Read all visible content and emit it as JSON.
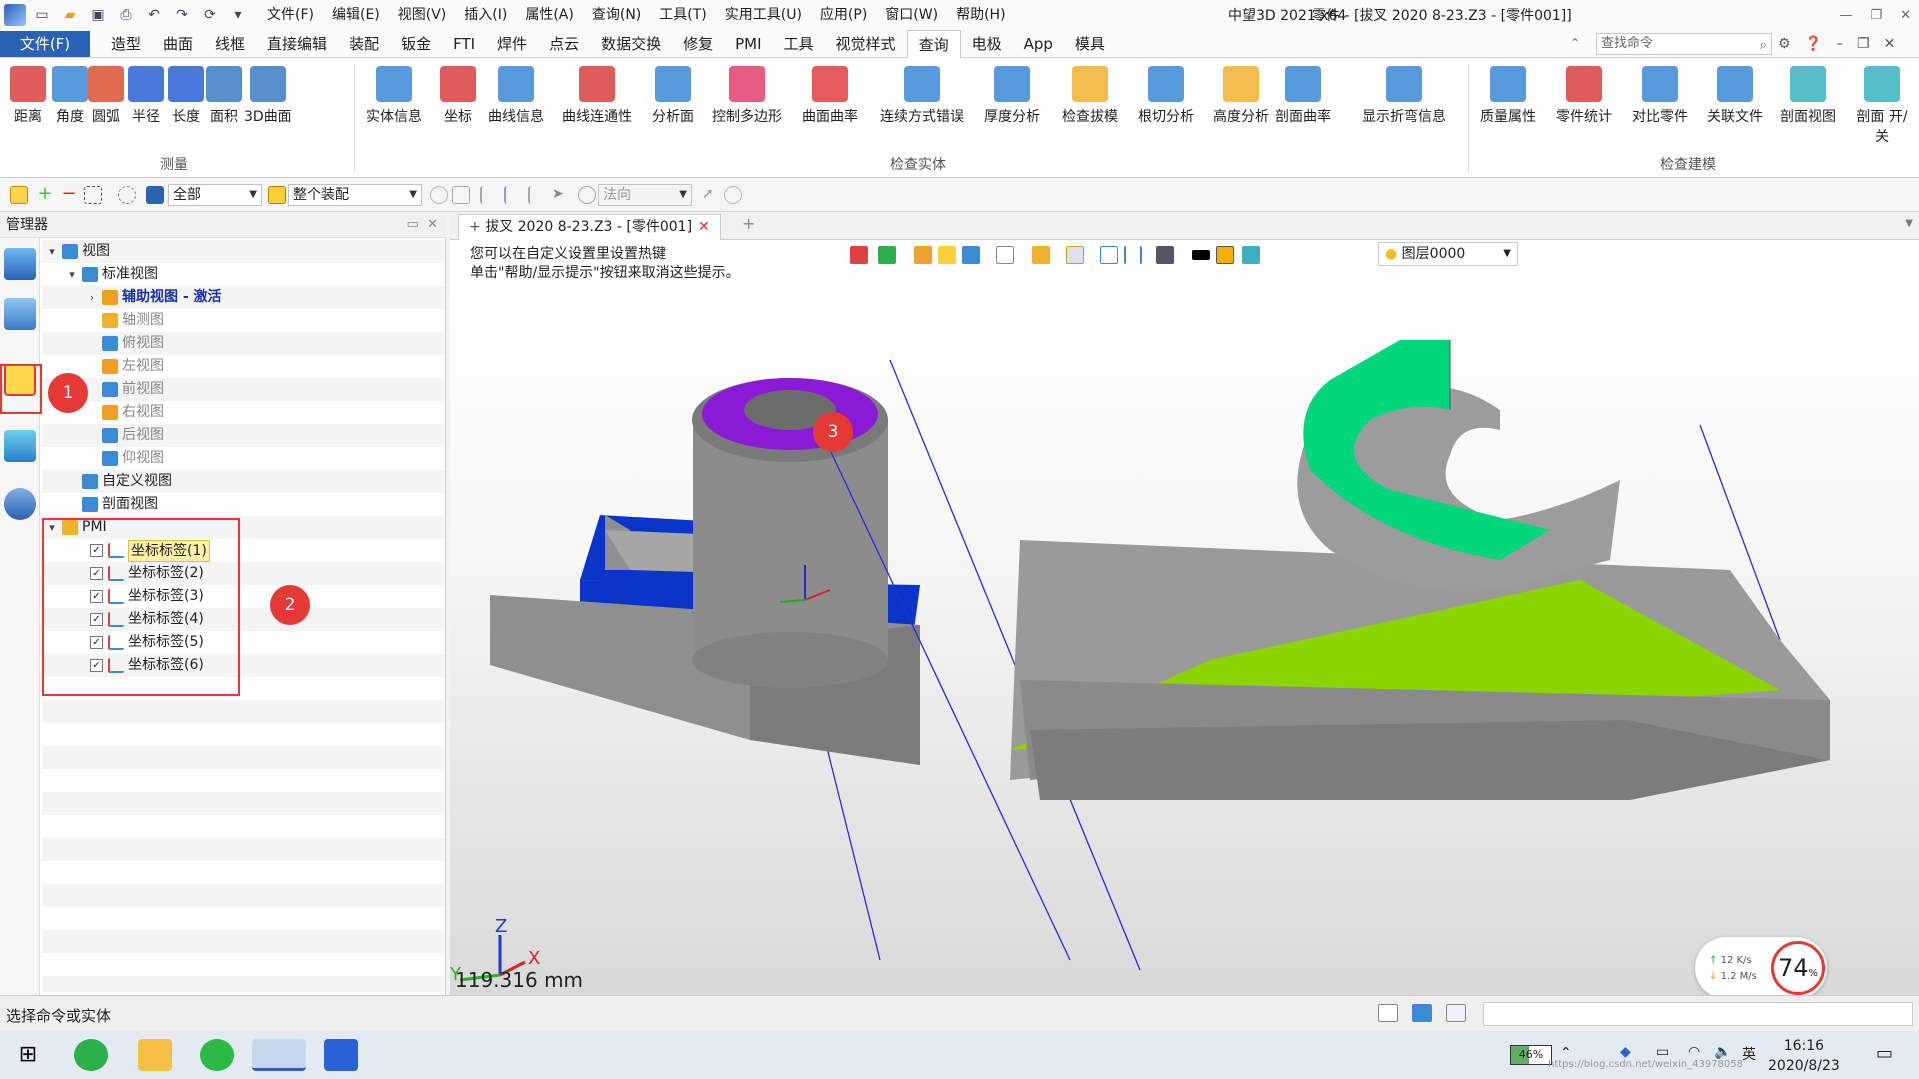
{
  "quick_access": [
    "file-new",
    "folder-open",
    "save",
    "print",
    "undo",
    "redo",
    "refresh",
    "more"
  ],
  "menu": [
    "文件(F)",
    "编辑(E)",
    "视图(V)",
    "插入(I)",
    "属性(A)",
    "查询(N)",
    "工具(T)",
    "实用工具(U)",
    "应用(P)",
    "窗口(W)",
    "帮助(H)"
  ],
  "app_version": "中望3D 2021 x64",
  "doc_title": "零件 - [拔叉  2020  8-23.Z3 - [零件001]]",
  "ribbon_tabs": [
    "文件(F)",
    "造型",
    "曲面",
    "线框",
    "直接编辑",
    "装配",
    "钣金",
    "FTI",
    "焊件",
    "点云",
    "数据交换",
    "修复",
    "PMI",
    "工具",
    "视觉样式",
    "查询",
    "电极",
    "App",
    "模具"
  ],
  "active_tab": "查询",
  "search_placeholder": "查找命令",
  "ribbon": {
    "measure": {
      "label": "测量",
      "buttons": [
        "距离",
        "角度",
        "圆弧",
        "半径",
        "长度",
        "面积",
        "3D曲面"
      ]
    },
    "inspect_entity": {
      "label": "检查实体",
      "buttons": [
        "实体信息",
        "坐标",
        "曲线信息",
        "曲线连通性",
        "分析面",
        "控制多边形",
        "曲面曲率",
        "连续方式错误",
        "厚度分析",
        "检查拔模",
        "根切分析",
        "高度分析",
        "剖面曲率",
        "显示折弯信息"
      ]
    },
    "inspect_model": {
      "label": "检查建模",
      "buttons": [
        "质量属性",
        "零件统计",
        "对比零件",
        "关联文件",
        "剖面视图",
        "剖面 开/关"
      ]
    }
  },
  "toolbar2": {
    "filter_value": "全部",
    "scope_value": "整个装配",
    "direction_value": "法向"
  },
  "manager": {
    "title": "管理器",
    "tree": [
      {
        "label": "视图",
        "level": 0,
        "exp": "v"
      },
      {
        "label": "标准视图",
        "level": 1,
        "exp": "v"
      },
      {
        "label": "辅助视图 - 激活",
        "level": 2,
        "exp": ">",
        "style": "bold"
      },
      {
        "label": "轴测图",
        "level": 2,
        "style": "gray"
      },
      {
        "label": "俯视图",
        "level": 2,
        "style": "gray"
      },
      {
        "label": "左视图",
        "level": 2,
        "style": "gray"
      },
      {
        "label": "前视图",
        "level": 2,
        "style": "gray"
      },
      {
        "label": "右视图",
        "level": 2,
        "style": "gray"
      },
      {
        "label": "后视图",
        "level": 2,
        "style": "gray"
      },
      {
        "label": "仰视图",
        "level": 2,
        "style": "gray"
      },
      {
        "label": "自定义视图",
        "level": 1
      },
      {
        "label": "剖面视图",
        "level": 1
      },
      {
        "label": "PMI",
        "level": 0,
        "exp": "v"
      },
      {
        "label": "坐标标签(1)",
        "level": 1,
        "check": true,
        "selected": true
      },
      {
        "label": "坐标标签(2)",
        "level": 1,
        "check": true
      },
      {
        "label": "坐标标签(3)",
        "level": 1,
        "check": true
      },
      {
        "label": "坐标标签(4)",
        "level": 1,
        "check": true
      },
      {
        "label": "坐标标签(5)",
        "level": 1,
        "check": true
      },
      {
        "label": "坐标标签(6)",
        "level": 1,
        "check": true
      }
    ]
  },
  "doc_tab": "拔叉  2020  8-23.Z3 - [零件001]",
  "hint_lines": [
    "您可以在自定义设置里设置热键",
    "单击\"帮助/显示提示\"按钮来取消这些提示。"
  ],
  "layer": "图层0000",
  "scale_text": "119.316 mm",
  "axis_labels": {
    "z": "Z",
    "x": "X",
    "y": "Y"
  },
  "net_speed": {
    "up": "12  K/s",
    "down": "1.2  M/s"
  },
  "cpu": "74",
  "cpu_unit": "%",
  "badges": [
    "1",
    "2",
    "3"
  ],
  "status_text": "选择命令或实体",
  "taskbar": {
    "battery": "46%",
    "time": "16:16",
    "date": "2020/8/23",
    "watermark": "https://blog.csdn.net/weixin_43978058"
  },
  "colors": {
    "accent": "#2a62b6",
    "badge": "#e53935",
    "blue_face": "#1b3fd0",
    "purple_face": "#8a18d8",
    "green_face": "#00d27a",
    "lime_face": "#88dd00",
    "body": "#8f8f8f"
  }
}
